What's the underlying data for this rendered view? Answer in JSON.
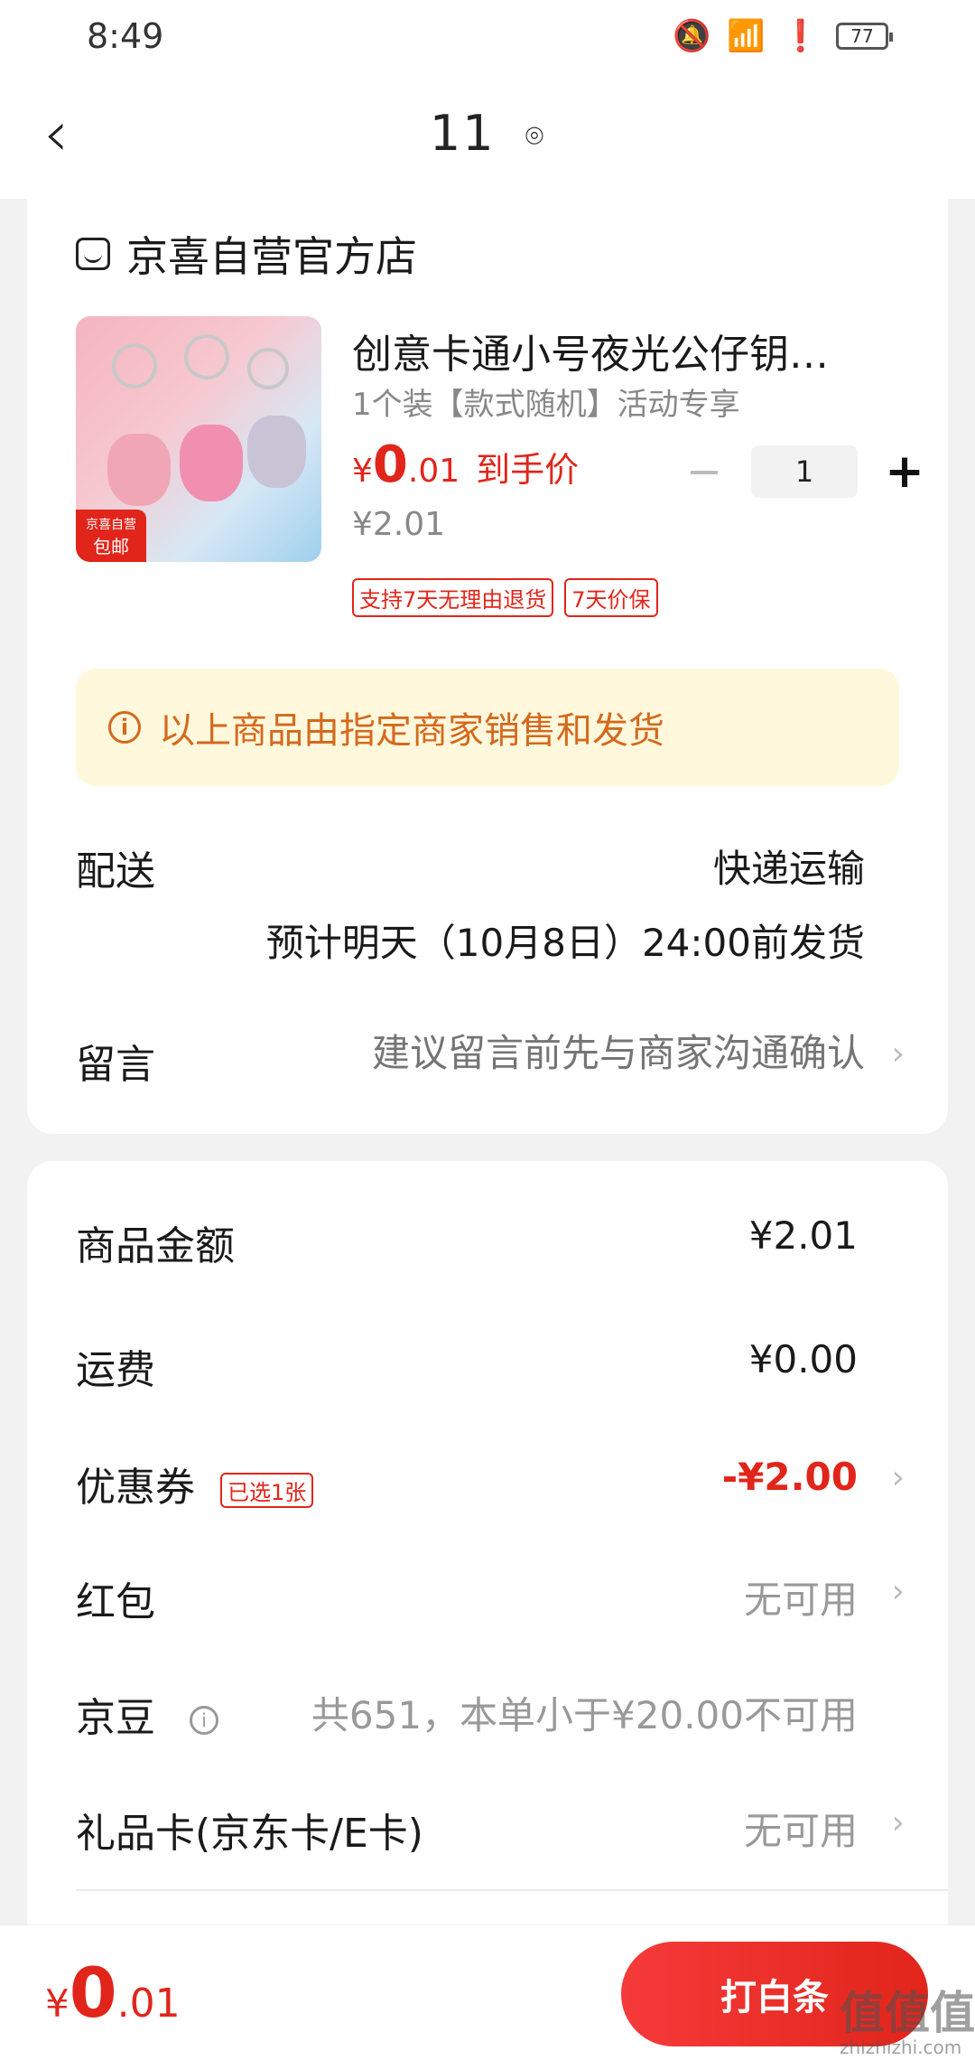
{
  "status_bar": {
    "time": "8:49",
    "battery": "77",
    "icons": [
      "mute-icon",
      "wifi-icon",
      "alert-icon",
      "battery-icon"
    ]
  },
  "header": {
    "title": "11",
    "back_icon": "chevron-left-icon",
    "location_icon": "location-pin-icon"
  },
  "shop": {
    "name": "京喜自营官方店",
    "icon": "store-icon"
  },
  "product": {
    "title": "创意卡通小号夜光公仔钥…",
    "spec": "1个装【款式随机】活动专享",
    "price_currency": "¥",
    "price_integer": "0",
    "price_decimal": ".01",
    "price_label": "到手价",
    "original_price": "¥2.01",
    "quantity": "1",
    "minus_label": "−",
    "plus_label": "+",
    "image_badge_top": "京喜自营",
    "image_badge_bottom": "包邮",
    "tags": [
      "支持7天无理由退货",
      "7天价保"
    ]
  },
  "notice": {
    "icon": "info-icon",
    "icon_glyph": "i",
    "text": "以上商品由指定商家销售和发货"
  },
  "delivery": {
    "label": "配送",
    "method": "快递运输",
    "eta": "预计明天（10月8日）24:00前发货"
  },
  "message": {
    "label": "留言",
    "placeholder": "建议留言前先与商家沟通确认",
    "chevron": "›"
  },
  "summary": {
    "goods_amount_label": "商品金额",
    "goods_amount_value": "¥2.01",
    "shipping_label": "运费",
    "shipping_value": "¥0.00",
    "coupon_label": "优惠券",
    "coupon_badge": "已选1张",
    "coupon_value": "-¥2.00",
    "red_packet_label": "红包",
    "red_packet_value": "无可用",
    "jingdou_label": "京豆",
    "jingdou_value": "共651，本单小于¥20.00不可用",
    "gift_card_label": "礼品卡(京东卡/E卡)",
    "gift_card_value": "无可用",
    "chevron": "›"
  },
  "bottom": {
    "total_currency": "¥",
    "total_integer": "0",
    "total_decimal": ".01",
    "pay_label": "打白条"
  },
  "watermark": {
    "text": "值值值",
    "sub": "zhizhizhi.com"
  },
  "colors": {
    "accent_red": "#e1251b",
    "notice_bg": "#fff8dc",
    "notice_text": "#d4691d"
  }
}
